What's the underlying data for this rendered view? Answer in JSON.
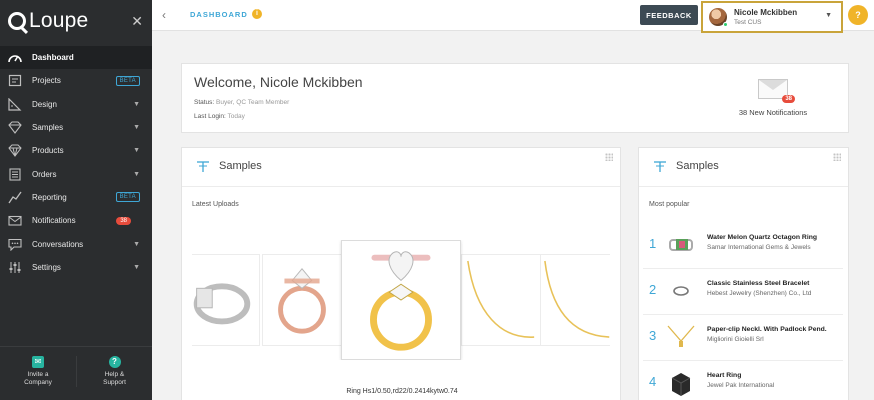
{
  "app": {
    "logo_text": "Loupe"
  },
  "sidebar": {
    "items": [
      {
        "label": "Dashboard",
        "icon": "dashboard-icon",
        "active": true
      },
      {
        "label": "Projects",
        "icon": "projects-icon",
        "badge": "BETA"
      },
      {
        "label": "Design",
        "icon": "design-icon",
        "caret": true
      },
      {
        "label": "Samples",
        "icon": "samples-icon",
        "caret": true
      },
      {
        "label": "Products",
        "icon": "products-icon",
        "caret": true
      },
      {
        "label": "Orders",
        "icon": "orders-icon",
        "caret": true
      },
      {
        "label": "Reporting",
        "icon": "reporting-icon",
        "badge": "BETA"
      },
      {
        "label": "Notifications",
        "icon": "notifications-icon",
        "count": "38"
      },
      {
        "label": "Conversations",
        "icon": "conversations-icon",
        "caret": true
      },
      {
        "label": "Settings",
        "icon": "settings-icon",
        "caret": true
      }
    ],
    "bottom": {
      "invite_line1": "Invite a",
      "invite_line2": "Company",
      "help_line1": "Help &",
      "help_line2": "Support"
    }
  },
  "topbar": {
    "breadcrumb": "DASHBOARD",
    "feedback_label": "FEEDBACK",
    "user_name": "Nicole Mckibben",
    "user_org": "Test CUS",
    "help_label": "?"
  },
  "welcome": {
    "title": "Welcome, Nicole Mckibben",
    "status_label": "Status:",
    "status_value": "Buyer, QC Team Member",
    "last_login_label": "Last Login:",
    "last_login_value": "Today",
    "notif_count": "38",
    "notif_text": "38 New Notifications"
  },
  "samples_main": {
    "title": "Samples",
    "sub_label": "Latest Uploads",
    "caption": "Ring Hs1/0.50,rd22/0.2414kytw0.74"
  },
  "samples_side": {
    "title": "Samples",
    "sub_label": "Most popular",
    "items": [
      {
        "rank": "1",
        "name": "Water Melon Quartz Octagon Ring",
        "vendor": "Samar International Gems & Jewels"
      },
      {
        "rank": "2",
        "name": "Classic Stainless Steel Bracelet",
        "vendor": "Hebest Jewelry (Shenzhen) Co., Ltd"
      },
      {
        "rank": "3",
        "name": "Paper-clip Neckl. With Padlock Pend.",
        "vendor": "Migliorini Gioielli Srl"
      },
      {
        "rank": "4",
        "name": "Heart Ring",
        "vendor": "Jewel Pak International"
      }
    ]
  },
  "colors": {
    "accent": "#3fa7d6",
    "sidebar_bg": "#2b2d2f",
    "badge_red": "#e74c3c",
    "highlight": "#c9a43a"
  }
}
